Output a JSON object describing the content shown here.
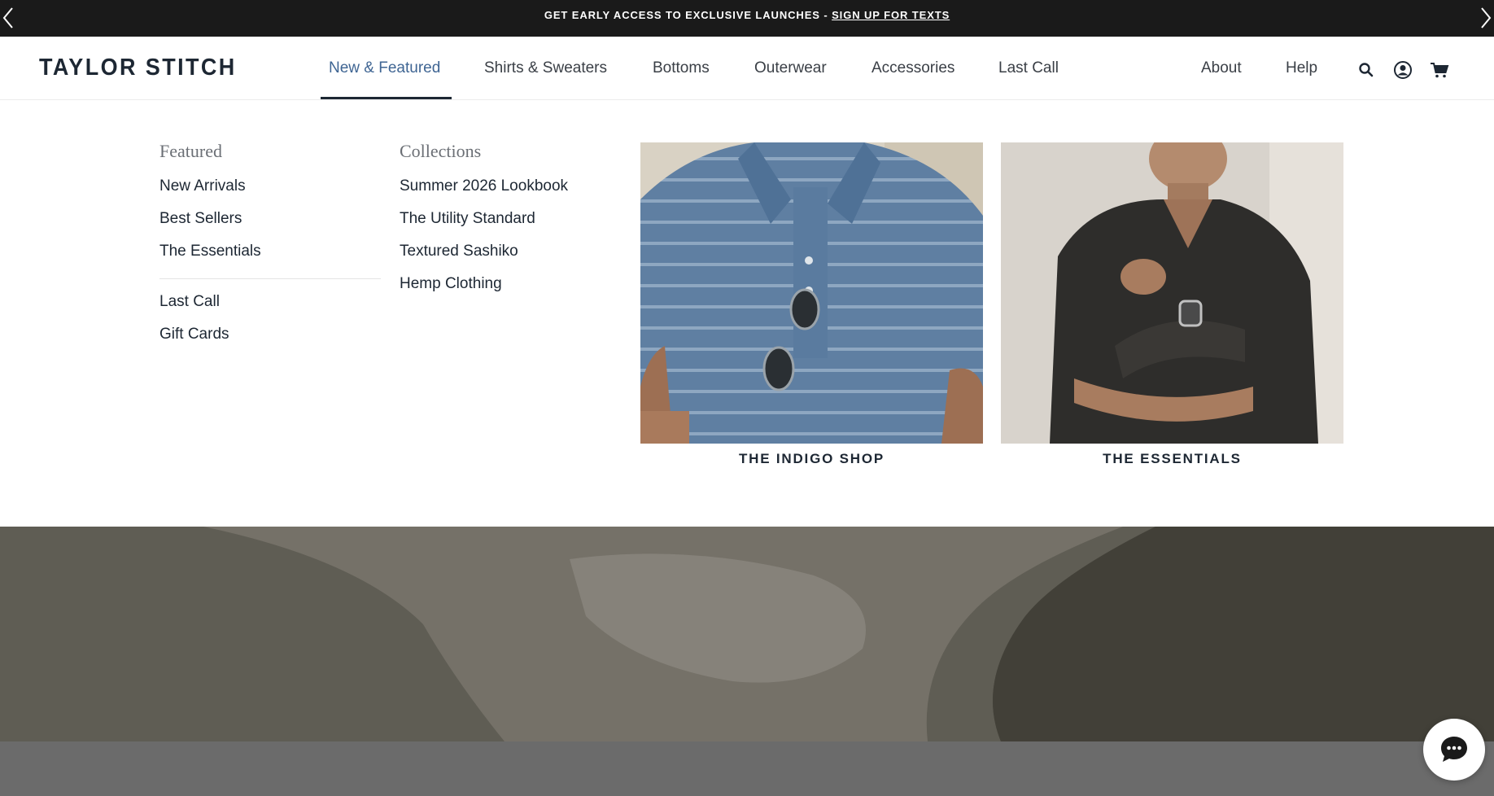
{
  "announcement": {
    "text": "GET EARLY ACCESS TO EXCLUSIVE LAUNCHES - ",
    "link": "SIGN UP FOR TEXTS",
    "prev_icon": "chevron-left-icon",
    "next_icon": "chevron-right-icon"
  },
  "header": {
    "logo": "TAYLOR STITCH",
    "nav": [
      {
        "label": "New & Featured",
        "active": true
      },
      {
        "label": "Shirts & Sweaters"
      },
      {
        "label": "Bottoms"
      },
      {
        "label": "Outerwear"
      },
      {
        "label": "Accessories"
      },
      {
        "label": "Last Call"
      }
    ],
    "secondary": [
      "About",
      "Help"
    ],
    "icons": [
      "search-icon",
      "account-icon",
      "cart-icon"
    ],
    "active_color": "#3f6593"
  },
  "mega_menu": {
    "featured": {
      "heading": "Featured",
      "links": [
        "New Arrivals",
        "Best Sellers",
        "The Essentials"
      ],
      "links_secondary": [
        "Last Call",
        "Gift Cards"
      ]
    },
    "collections": {
      "heading": "Collections",
      "links": [
        "Summer 2026 Lookbook",
        "The Utility Standard",
        "Textured Sashiko",
        "Hemp Clothing"
      ]
    },
    "promos": [
      {
        "label": "THE INDIGO SHOP"
      },
      {
        "label": "THE ESSENTIALS"
      }
    ]
  },
  "chat": {
    "icon": "chat-bubble-icon"
  }
}
